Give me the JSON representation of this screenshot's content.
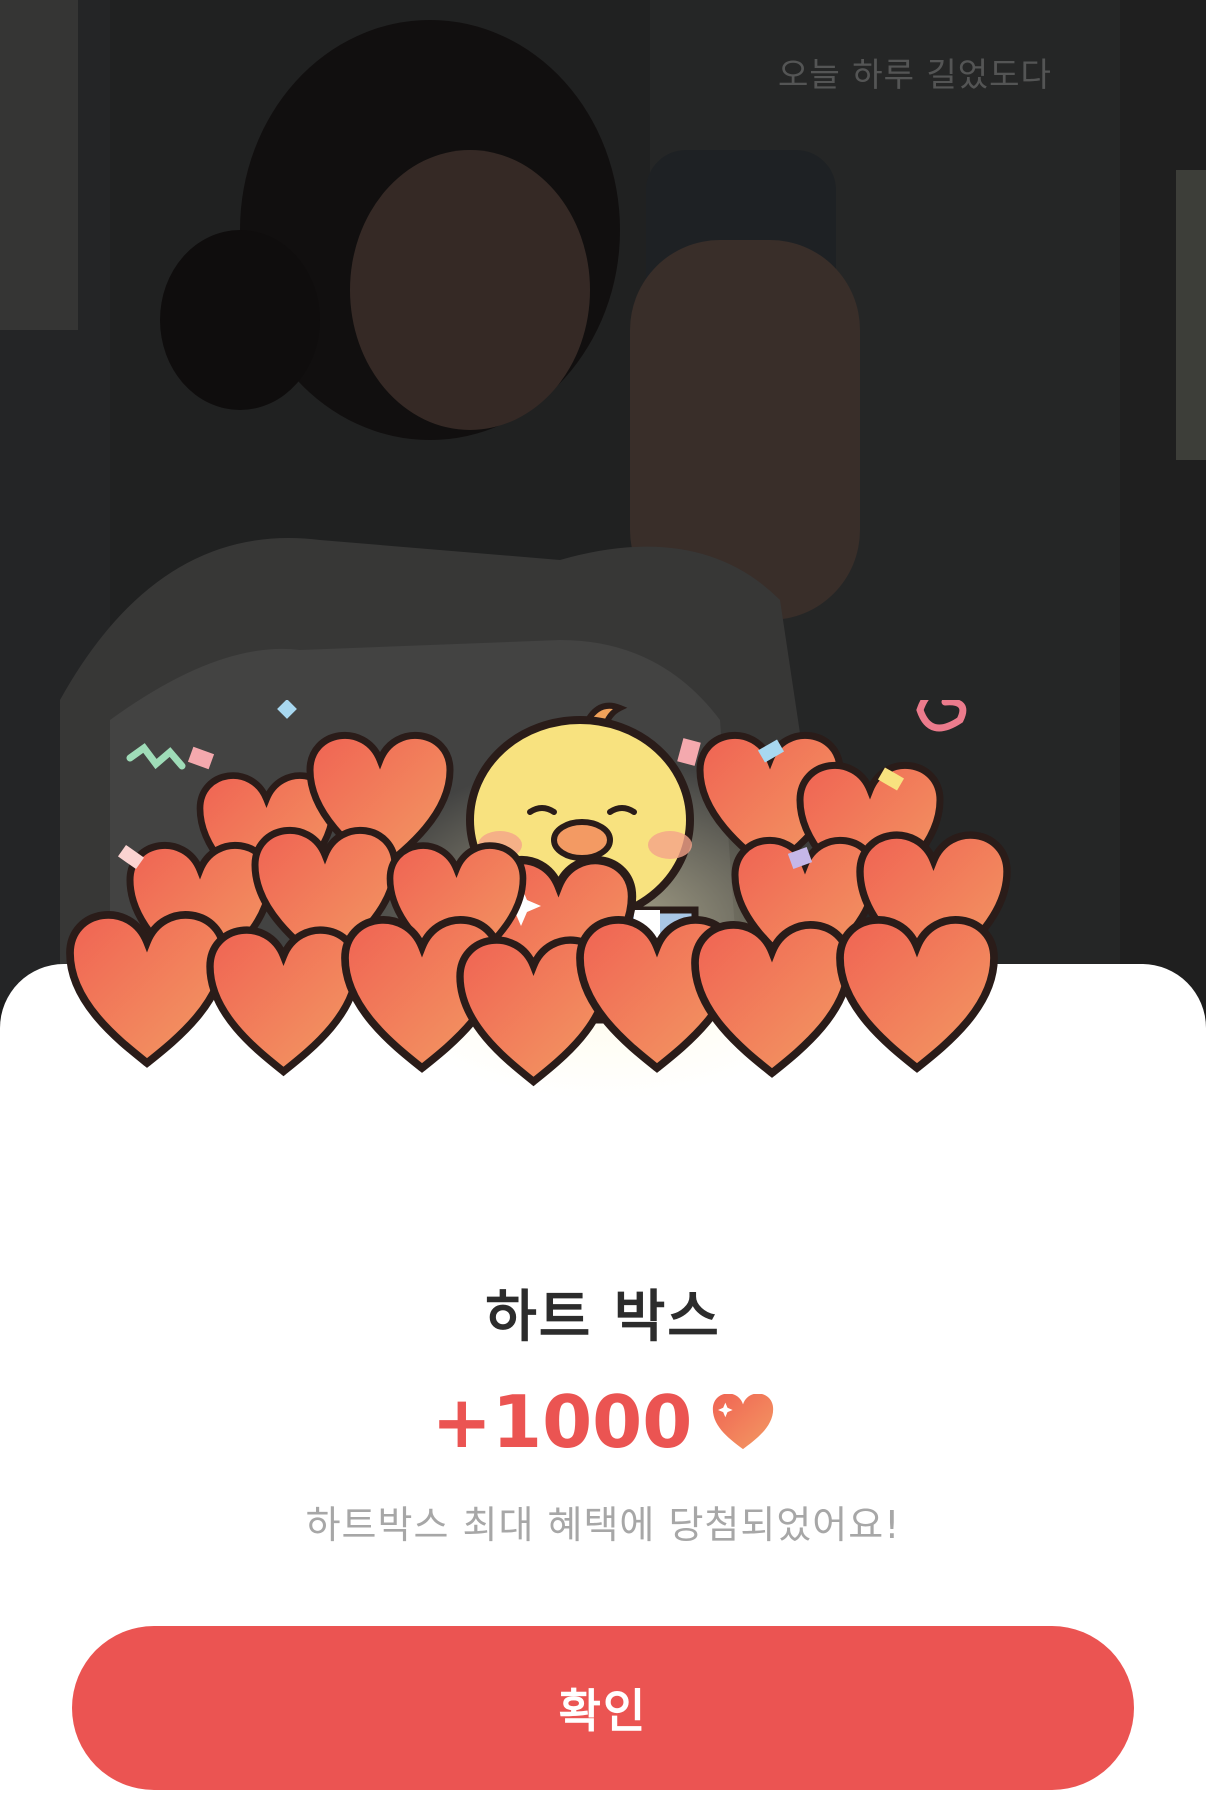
{
  "background": {
    "caption": "오늘 하루 길었도다"
  },
  "popup": {
    "title": "하트 박스",
    "reward_amount": "+1000",
    "reward_icon": "heart-icon",
    "message": "하트박스 최대 혜택에 당첨되었어요!",
    "confirm_label": "확인"
  },
  "colors": {
    "accent": "#eb5452",
    "title": "#2c2c2c",
    "message": "#a7a7a7",
    "sheet": "#ffffff"
  }
}
